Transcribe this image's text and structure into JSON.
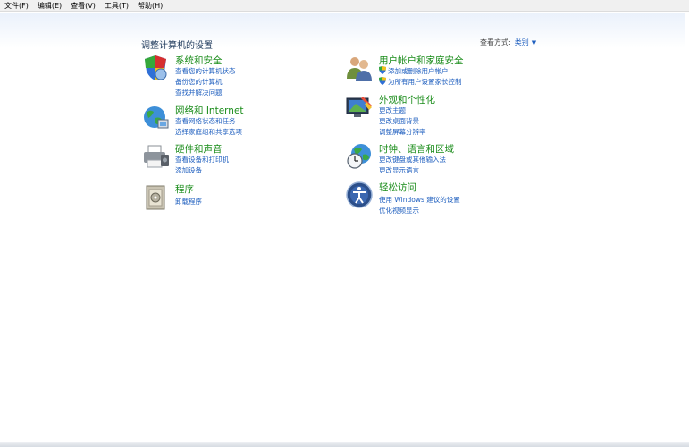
{
  "menubar": {
    "items": [
      "文件(F)",
      "编辑(E)",
      "查看(V)",
      "工具(T)",
      "帮助(H)"
    ]
  },
  "page": {
    "title": "调整计算机的设置",
    "view_by_label": "查看方式:",
    "view_by_value": "类别"
  },
  "categories": {
    "system": {
      "title": "系统和安全",
      "links": [
        "查看您的计算机状态",
        "备份您的计算机",
        "查找并解决问题"
      ]
    },
    "network": {
      "title": "网络和 Internet",
      "links": [
        "查看网络状态和任务",
        "选择家庭组和共享选项"
      ]
    },
    "hardware": {
      "title": "硬件和声音",
      "links": [
        "查看设备和打印机",
        "添加设备"
      ]
    },
    "programs": {
      "title": "程序",
      "links": [
        "卸载程序"
      ]
    },
    "users": {
      "title": "用户帐户和家庭安全",
      "links": [
        "添加或删除用户帐户",
        "为所有用户设置家长控制"
      ]
    },
    "appearance": {
      "title": "外观和个性化",
      "links": [
        "更改主题",
        "更改桌面背景",
        "调整屏幕分辨率"
      ]
    },
    "clock": {
      "title": "时钟、语言和区域",
      "links": [
        "更改键盘或其他输入法",
        "更改显示语言"
      ]
    },
    "ease": {
      "title": "轻松访问",
      "links": [
        "使用 Windows 建议的设置",
        "优化视频显示"
      ]
    }
  },
  "colors": {
    "category_title": "#1a8c1a",
    "link": "#1f5fbf",
    "heading": "#1e395b"
  }
}
